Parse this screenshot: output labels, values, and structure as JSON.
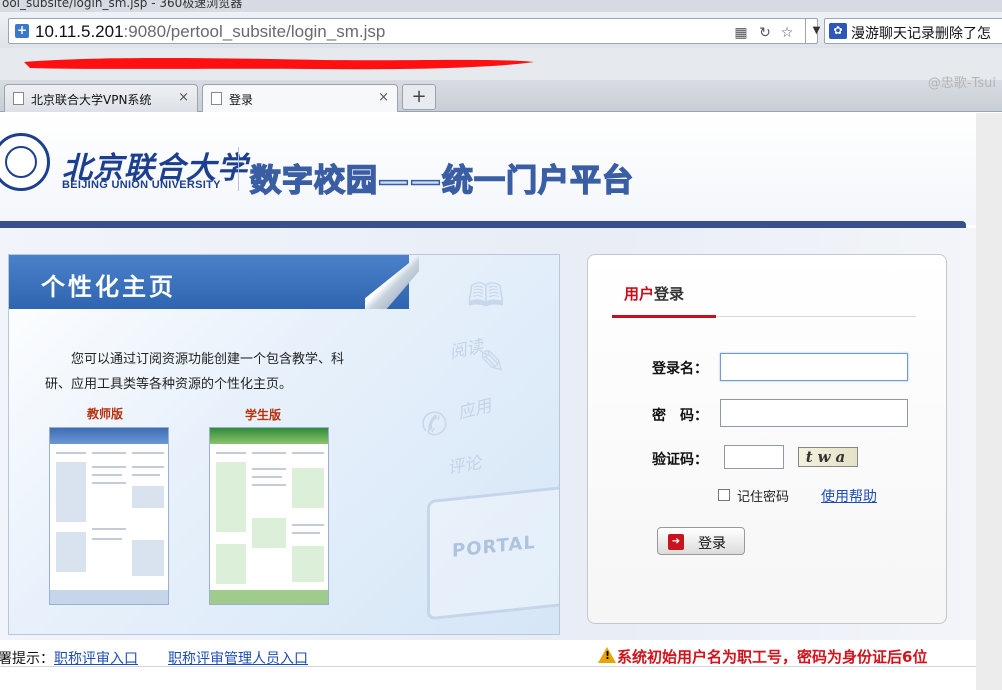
{
  "browser": {
    "title_partial": "ool_subsite/login_sm.jsp - 360极速浏览器",
    "url": {
      "host": "10.11.5.201",
      "rest": ":9080/pertool_subsite/login_sm.jsp"
    },
    "search_text": "漫游聊天记录删除了怎",
    "tabs": [
      {
        "label": "北京联合大学VPN系统",
        "close": "×"
      },
      {
        "label": "登录",
        "close": "×"
      }
    ],
    "new_tab": "+",
    "watermark": "@忠歌-Tsui",
    "redaction_color": "#ff1010"
  },
  "header": {
    "university_cn": "北京联合大学",
    "university_en": "BEIJING UNION UNIVERSITY",
    "portal_title": "数字校园——统一门户平台",
    "brand_color": "#1d3f8f"
  },
  "promo": {
    "title": "个性化主页",
    "description": "您可以通过订阅资源功能创建一个包含教学、科研、应用工具类等各种资源的个性化主页。",
    "teacher_label": "教师版",
    "student_label": "学生版",
    "deco_read": "阅读",
    "deco_use": "应用",
    "deco_review": "评论",
    "portal_label": "PORTAL"
  },
  "login": {
    "tab_part1": "用户",
    "tab_part2": "登录",
    "username_label": "登录名：",
    "password_label": "密　码：",
    "captcha_label": "验证码：",
    "username_value": "",
    "password_value": "",
    "captcha_value": "",
    "captcha_text": "twa",
    "remember_label": "记住密码",
    "help_link": "使用帮助",
    "submit_label": "登录",
    "accent_color": "#c2111b"
  },
  "footer": {
    "tip_prefix": "署提示：",
    "link_review": "职称评审入口",
    "link_review_mgr": "职称评审管理人员入口",
    "notice": "系统初始用户名为职工号，密码为身份证后6位"
  }
}
